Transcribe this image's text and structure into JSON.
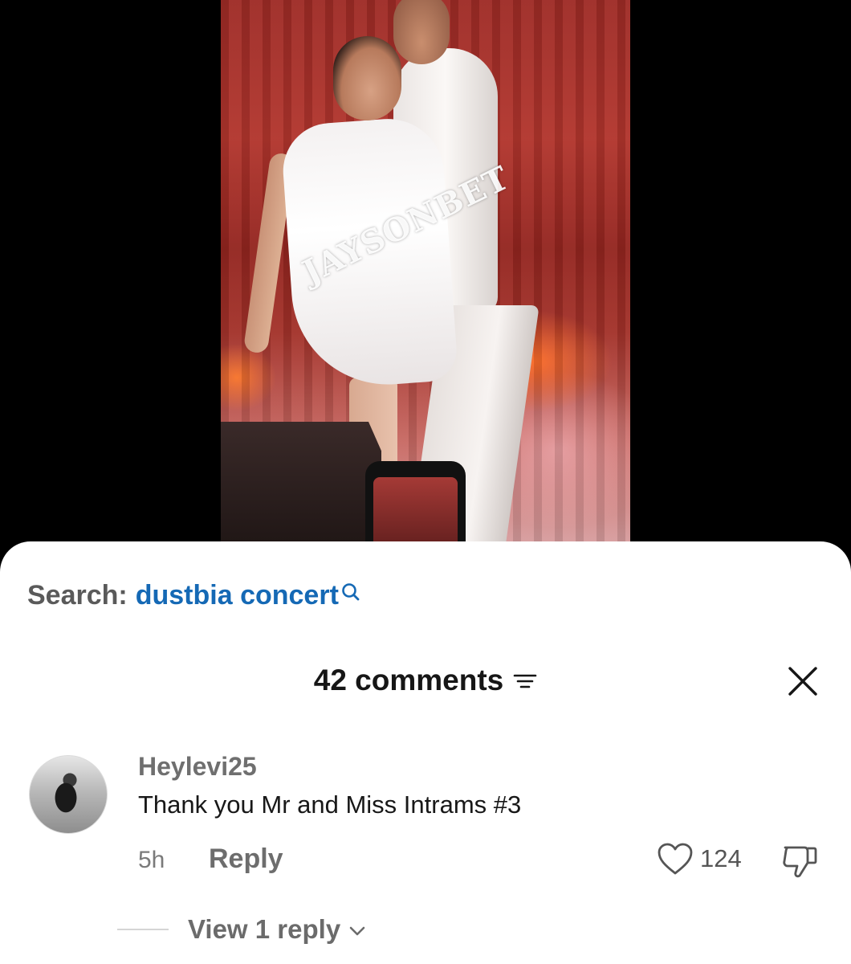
{
  "video": {
    "watermark": "JAYSONBET"
  },
  "search": {
    "prefix": "Search:",
    "query": "dustbia concert"
  },
  "comments": {
    "header": "42 comments",
    "items": [
      {
        "username": "Heylevi25",
        "text": "Thank you Mr and Miss Intrams #3",
        "time": "5h",
        "reply_label": "Reply",
        "like_count": "124",
        "view_replies_label": "View 1 reply"
      }
    ]
  },
  "icons": {
    "search": "search-icon",
    "filter": "filter-icon",
    "close": "close-icon",
    "like": "heart-outline-icon",
    "dislike": "thumbs-down-icon",
    "expand": "chevron-down-icon"
  },
  "colors": {
    "search_query": "#1569b5",
    "sheet_background": "#ffffff",
    "video_letterbox": "#000000"
  }
}
